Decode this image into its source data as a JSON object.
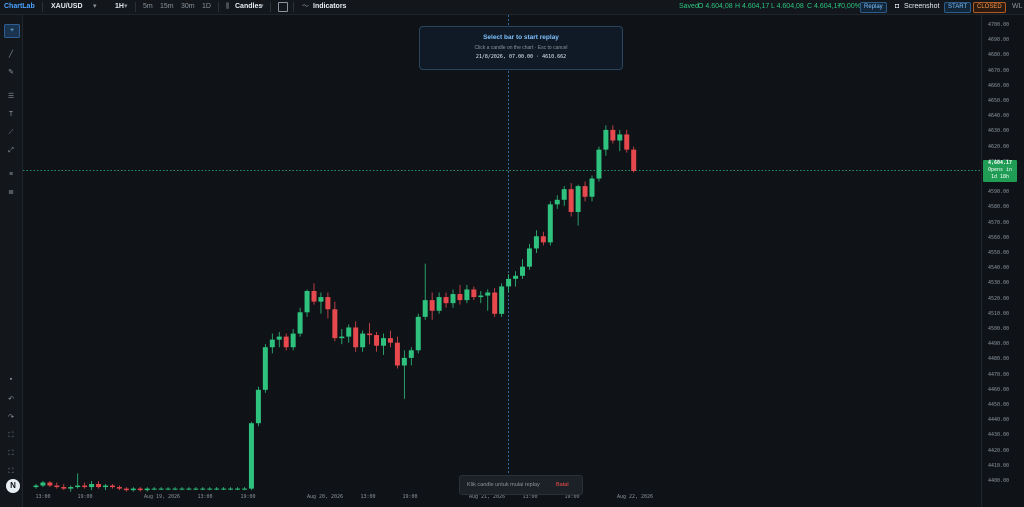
{
  "topbar": {
    "brand": "ChartLab",
    "symbol": "XAU/USD",
    "interval": "1H",
    "timeframes": [
      "5m",
      "15m",
      "30m",
      "1D"
    ],
    "chart_type": "Candles",
    "indicators": "Indicators",
    "status": "Saved",
    "ohlc": {
      "o": "O 4.604,08",
      "h": "H 4.604,17",
      "l": "L 4.604,08",
      "c": "C 4.604,17",
      "chg": "+0,00%"
    },
    "replay": "Replay",
    "screenshot": "Screenshot",
    "start": "START",
    "closed": "CLOSED",
    "extra": "WL"
  },
  "replay_panel": {
    "title": "Select bar to start replay",
    "hint": "Click a candle on the chart · Esc to cancel",
    "selection": "21/8/2026, 07.00.00 · 4610.662"
  },
  "toast": {
    "message": "Klik candle untuk mulai replay",
    "cancel": "Batal"
  },
  "price_tag": {
    "price": "4,604.17",
    "line1": "Opens in",
    "line2": "1d 18h"
  },
  "colors": {
    "up": "#2ec27e",
    "down": "#e5484d",
    "accent": "#4aa3ff",
    "crosshair": "#3b82c4",
    "price_line": "#2ec27e"
  },
  "chart_data": {
    "type": "candlestick",
    "y_ticks": [
      "4700.00",
      "4690.00",
      "4680.00",
      "4670.00",
      "4660.00",
      "4650.00",
      "4640.00",
      "4630.00",
      "4620.00",
      "4610.00",
      "4600.00",
      "4590.00",
      "4580.00",
      "4570.00",
      "4560.00",
      "4550.00",
      "4540.00",
      "4530.00",
      "4520.00",
      "4510.00",
      "4500.00",
      "4490.00",
      "4480.00",
      "4470.00",
      "4460.00",
      "4450.00",
      "4440.00",
      "4430.00",
      "4420.00",
      "4410.00",
      "4400.00"
    ],
    "ylim": [
      4400,
      4700
    ],
    "x_ticks": [
      "13:00",
      "19:00",
      "Aug 19, 2026",
      "13:00",
      "19:00",
      "Aug 20, 2026",
      "13:00",
      "19:00",
      "Aug 21, 2026",
      "13:00",
      "19:00",
      "Aug 22, 2026"
    ],
    "last_price": 4604.17,
    "crosshair_bar": 68,
    "candles": [
      [
        4396,
        4398,
        4395,
        4397
      ],
      [
        4397,
        4400,
        4396,
        4399
      ],
      [
        4399,
        4400,
        4396,
        4397
      ],
      [
        4397,
        4399,
        4395,
        4396
      ],
      [
        4396,
        4398,
        4394,
        4395
      ],
      [
        4395,
        4397,
        4393,
        4396
      ],
      [
        4396,
        4405,
        4395,
        4397
      ],
      [
        4397,
        4399,
        4395,
        4396
      ],
      [
        4396,
        4400,
        4394,
        4398
      ],
      [
        4398,
        4400,
        4395,
        4396
      ],
      [
        4396,
        4398,
        4394,
        4397
      ],
      [
        4397,
        4398,
        4395,
        4396
      ],
      [
        4396,
        4397,
        4394,
        4395
      ],
      [
        4395,
        4396,
        4393,
        4394
      ],
      [
        4394,
        4396,
        4393,
        4395
      ],
      [
        4395,
        4396,
        4393,
        4394
      ],
      [
        4394,
        4396,
        4393,
        4395
      ],
      [
        4395,
        4396,
        4394,
        4395
      ],
      [
        4395,
        4396,
        4394,
        4395
      ],
      [
        4395,
        4396,
        4394,
        4395
      ],
      [
        4395,
        4396,
        4394,
        4395
      ],
      [
        4395,
        4396,
        4394,
        4395
      ],
      [
        4395,
        4396,
        4394,
        4395
      ],
      [
        4395,
        4396,
        4394,
        4395
      ],
      [
        4395,
        4396,
        4394,
        4395
      ],
      [
        4395,
        4396,
        4394,
        4395
      ],
      [
        4395,
        4396,
        4394,
        4395
      ],
      [
        4395,
        4396,
        4394,
        4395
      ],
      [
        4395,
        4396,
        4394,
        4395
      ],
      [
        4395,
        4396,
        4394,
        4395
      ],
      [
        4395,
        4396,
        4394,
        4395
      ],
      [
        4395,
        4439,
        4394,
        4438
      ],
      [
        4438,
        4462,
        4436,
        4460
      ],
      [
        4460,
        4490,
        4458,
        4488
      ],
      [
        4488,
        4497,
        4484,
        4493
      ],
      [
        4493,
        4498,
        4488,
        4495
      ],
      [
        4495,
        4497,
        4486,
        4488
      ],
      [
        4488,
        4500,
        4486,
        4497
      ],
      [
        4497,
        4514,
        4495,
        4511
      ],
      [
        4511,
        4526,
        4508,
        4525
      ],
      [
        4525,
        4530,
        4516,
        4518
      ],
      [
        4518,
        4524,
        4510,
        4521
      ],
      [
        4521,
        4524,
        4507,
        4513
      ],
      [
        4513,
        4518,
        4492,
        4494
      ],
      [
        4494,
        4500,
        4490,
        4495
      ],
      [
        4495,
        4503,
        4491,
        4501
      ],
      [
        4501,
        4505,
        4485,
        4488
      ],
      [
        4488,
        4499,
        4485,
        4497
      ],
      [
        4497,
        4504,
        4490,
        4496
      ],
      [
        4496,
        4498,
        4485,
        4489
      ],
      [
        4489,
        4497,
        4483,
        4494
      ],
      [
        4494,
        4499,
        4488,
        4491
      ],
      [
        4491,
        4495,
        4474,
        4476
      ],
      [
        4476,
        4486,
        4454,
        4481
      ],
      [
        4481,
        4488,
        4476,
        4486
      ],
      [
        4486,
        4510,
        4484,
        4508
      ],
      [
        4508,
        4543,
        4506,
        4519
      ],
      [
        4519,
        4524,
        4506,
        4512
      ],
      [
        4512,
        4524,
        4510,
        4521
      ],
      [
        4521,
        4524,
        4514,
        4517
      ],
      [
        4517,
        4526,
        4514,
        4523
      ],
      [
        4523,
        4529,
        4516,
        4519
      ],
      [
        4519,
        4529,
        4517,
        4526
      ],
      [
        4526,
        4528,
        4519,
        4521
      ],
      [
        4521,
        4525,
        4517,
        4522
      ],
      [
        4522,
        4526,
        4512,
        4524
      ],
      [
        4524,
        4527,
        4508,
        4510
      ],
      [
        4510,
        4530,
        4508,
        4528
      ],
      [
        4528,
        4536,
        4524,
        4533
      ],
      [
        4533,
        4538,
        4528,
        4535
      ],
      [
        4535,
        4546,
        4533,
        4541
      ],
      [
        4541,
        4556,
        4539,
        4553
      ],
      [
        4553,
        4565,
        4550,
        4561
      ],
      [
        4561,
        4564,
        4555,
        4557
      ],
      [
        4557,
        4584,
        4555,
        4582
      ],
      [
        4582,
        4588,
        4579,
        4585
      ],
      [
        4585,
        4594,
        4581,
        4592
      ],
      [
        4592,
        4596,
        4574,
        4577
      ],
      [
        4577,
        4595,
        4568,
        4594
      ],
      [
        4594,
        4597,
        4584,
        4587
      ],
      [
        4587,
        4601,
        4584,
        4599
      ],
      [
        4599,
        4620,
        4597,
        4618
      ],
      [
        4618,
        4634,
        4614,
        4631
      ],
      [
        4631,
        4634,
        4622,
        4624
      ],
      [
        4624,
        4631,
        4617,
        4628
      ],
      [
        4628,
        4631,
        4616,
        4618
      ],
      [
        4618,
        4620,
        4603,
        4604
      ]
    ]
  }
}
